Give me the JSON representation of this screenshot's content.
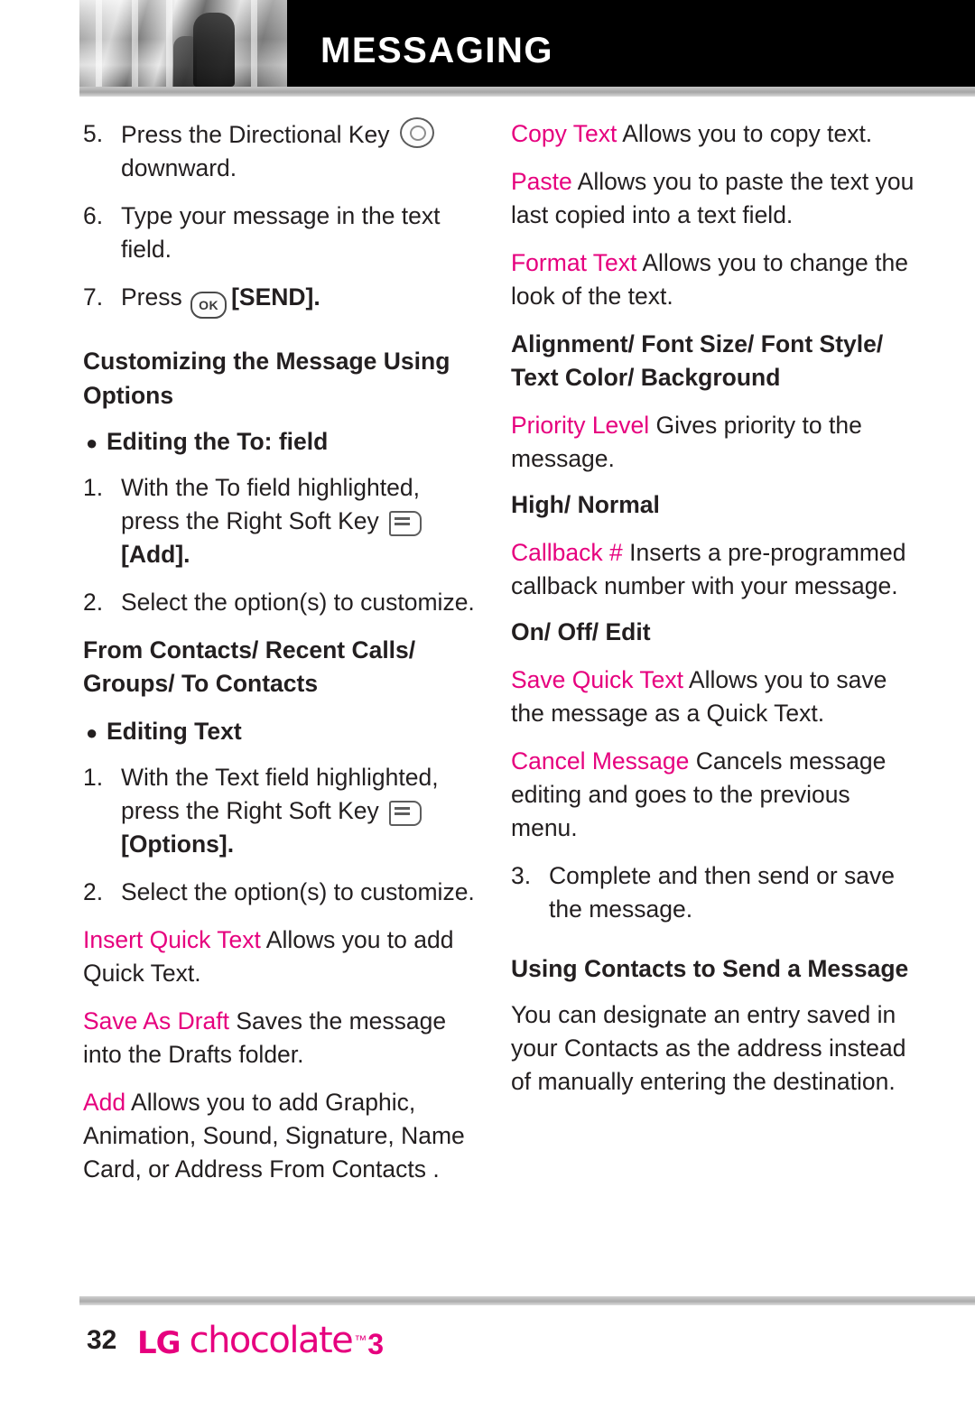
{
  "header": {
    "title": "MESSAGING",
    "photo_alt": "grayscale-photo-strip"
  },
  "left_column": [
    {
      "type": "numbered",
      "num": "5.",
      "parts": [
        {
          "t": "Press the Directional Key "
        },
        {
          "icon": "directional-key-icon"
        },
        {
          "t": " downward."
        }
      ]
    },
    {
      "type": "numbered",
      "num": "6.",
      "parts": [
        {
          "t": "Type your message in the text field."
        }
      ]
    },
    {
      "type": "numbered",
      "num": "7.",
      "parts": [
        {
          "t": "Press "
        },
        {
          "icon": "ok-key-icon",
          "label": "OK"
        },
        {
          "t": " "
        },
        {
          "t": "[SEND].",
          "bold": true
        }
      ]
    },
    {
      "type": "heading",
      "text": "Customizing the Message Using Options"
    },
    {
      "type": "bullet",
      "text": "Editing the To: field"
    },
    {
      "type": "numbered",
      "num": "1.",
      "parts": [
        {
          "t": "With the To field highlighted, press the Right Soft Key "
        },
        {
          "icon": "right-soft-key-icon"
        },
        {
          "t": " "
        },
        {
          "t": "[Add].",
          "bold": true
        }
      ]
    },
    {
      "type": "numbered",
      "num": "2.",
      "parts": [
        {
          "t": "Select the option(s) to customize."
        }
      ]
    },
    {
      "type": "subbold",
      "text": "From Contacts/ Recent Calls/ Groups/ To Contacts"
    },
    {
      "type": "bullet",
      "text": "Editing Text"
    },
    {
      "type": "numbered",
      "num": "1.",
      "parts": [
        {
          "t": "With the Text field highlighted, press the Right Soft Key "
        },
        {
          "icon": "right-soft-key-icon"
        },
        {
          "t": " "
        },
        {
          "t": "[Options].",
          "bold": true
        }
      ]
    },
    {
      "type": "numbered",
      "num": "2.",
      "parts": [
        {
          "t": "Select the option(s) to customize."
        }
      ]
    },
    {
      "type": "para",
      "parts": [
        {
          "t": "Insert Quick Text",
          "magenta": true
        },
        {
          "t": " Allows you to add Quick Text."
        }
      ]
    },
    {
      "type": "para",
      "parts": [
        {
          "t": "Save As Draft",
          "magenta": true
        },
        {
          "t": " Saves the message into the Drafts folder."
        }
      ]
    },
    {
      "type": "para",
      "parts": [
        {
          "t": "Add",
          "magenta": true
        },
        {
          "t": "  Allows you to add Graphic, Animation, Sound, Signature, Name Card, or Address From Contacts ."
        }
      ]
    }
  ],
  "right_column": [
    {
      "type": "para",
      "parts": [
        {
          "t": "Copy Text",
          "magenta": true
        },
        {
          "t": "  Allows you to copy text."
        }
      ]
    },
    {
      "type": "para",
      "parts": [
        {
          "t": "Paste",
          "magenta": true
        },
        {
          "t": "  Allows you to paste the text you last copied into a text field."
        }
      ]
    },
    {
      "type": "para",
      "parts": [
        {
          "t": "Format Text",
          "magenta": true
        },
        {
          "t": "  Allows you to change the look of the text."
        }
      ]
    },
    {
      "type": "subbold",
      "text": "Alignment/ Font Size/ Font Style/ Text Color/ Background"
    },
    {
      "type": "para",
      "parts": [
        {
          "t": "Priority Level",
          "magenta": true
        },
        {
          "t": "  Gives priority to the message."
        }
      ]
    },
    {
      "type": "subbold",
      "text": "High/ Normal"
    },
    {
      "type": "para",
      "parts": [
        {
          "t": "Callback #",
          "magenta": true
        },
        {
          "t": "  Inserts a pre-programmed callback number with your message."
        }
      ]
    },
    {
      "type": "subbold",
      "text": "On/ Off/ Edit"
    },
    {
      "type": "para",
      "parts": [
        {
          "t": "Save Quick Text",
          "magenta": true
        },
        {
          "t": "  Allows you to save the message as a Quick Text."
        }
      ]
    },
    {
      "type": "para",
      "parts": [
        {
          "t": "Cancel Message",
          "magenta": true
        },
        {
          "t": "  Cancels message editing and goes to the previous menu."
        }
      ]
    },
    {
      "type": "numbered",
      "num": "3.",
      "parts": [
        {
          "t": "Complete and then send or save the message."
        }
      ]
    },
    {
      "type": "heading",
      "text": "Using Contacts to Send a Message"
    },
    {
      "type": "para",
      "parts": [
        {
          "t": "You can designate an entry saved in your Contacts as the address instead of manually entering the destination."
        }
      ]
    }
  ],
  "footer": {
    "page_number": "32",
    "logo_lg": "LG",
    "logo_brand": "chocolate",
    "logo_tm": "™",
    "logo_version": "3"
  },
  "colors": {
    "accent": "#e6007e",
    "text": "#231f20",
    "header_bg": "#000000"
  }
}
